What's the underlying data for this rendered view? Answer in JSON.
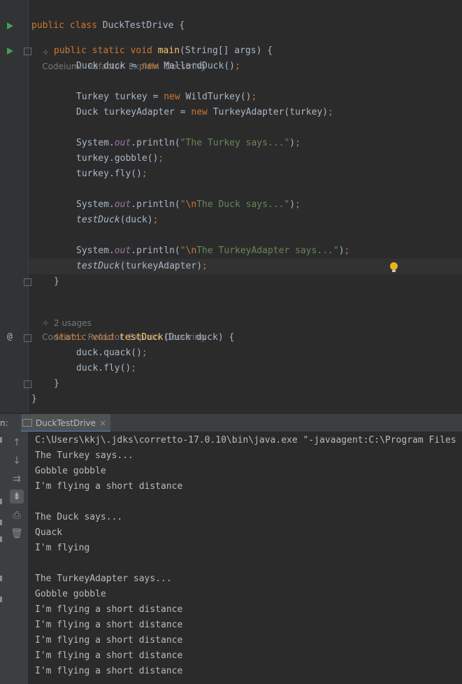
{
  "editor": {
    "class_line": {
      "kw": "public class ",
      "name": "DuckTestDrive",
      "rest": " {"
    },
    "codeium_hint": {
      "label": "Codeium:",
      "actions": [
        "Refactor",
        "Explain",
        "Docstring"
      ]
    },
    "main_sig": {
      "kw": "public static void ",
      "name": "main",
      "rest": "(String[] args) {"
    },
    "l_duck": {
      "pre": "Duck duck = ",
      "kw": "new ",
      "rest": "MallardDuck()",
      "semi": ";"
    },
    "l_turkey": {
      "pre": "Turkey turkey = ",
      "kw": "new ",
      "rest": "WildTurkey()",
      "semi": ";"
    },
    "l_adapter": {
      "pre": "Duck turkeyAdapter = ",
      "kw": "new ",
      "rest": "TurkeyAdapter(turkey)",
      "semi": ";"
    },
    "l_print1": {
      "a": "System.",
      "out": "out",
      "b": ".println(",
      "str": "\"The Turkey says...\"",
      "c": ")",
      "semi": ";"
    },
    "l_gobble": {
      "a": "turkey.gobble()",
      "semi": ";"
    },
    "l_fly": {
      "a": "turkey.fly()",
      "semi": ";"
    },
    "l_print2": {
      "a": "System.",
      "out": "out",
      "b": ".println(",
      "q": "\"",
      "esc": "\\n",
      "str": "The Duck says...\"",
      "c": ")",
      "semi": ";"
    },
    "l_test1": {
      "fn": "testDuck",
      "a": "(duck)",
      "semi": ";"
    },
    "l_print3": {
      "a": "System.",
      "out": "out",
      "b": ".println(",
      "q": "\"",
      "esc": "\\n",
      "str": "The TurkeyAdapter says...\"",
      "c": ")",
      "semi": ";"
    },
    "l_test2": {
      "fn": "testDuck",
      "a": "(turkeyAdapter)",
      "semi": ";"
    },
    "close_brace": "}",
    "usages": "2 usages",
    "test_sig": {
      "kw": "static void ",
      "name": "testDuck",
      "rest": "(Duck duck) {"
    },
    "l_quack": {
      "a": "duck.quack()",
      "semi": ";"
    },
    "l_dfly": {
      "a": "duck.fly()",
      "semi": ";"
    }
  },
  "run_panel": {
    "prefix": "n:",
    "tab_label": "DuckTestDrive",
    "close_glyph": "×",
    "output": [
      "C:\\Users\\kkj\\.jdks\\corretto-17.0.10\\bin\\java.exe \"-javaagent:C:\\Program Files",
      "The Turkey says...",
      "Gobble gobble",
      "I'm flying a short distance",
      "",
      "The Duck says...",
      "Quack",
      "I'm flying",
      "",
      "The TurkeyAdapter says...",
      "Gobble gobble",
      "I'm flying a short distance",
      "I'm flying a short distance",
      "I'm flying a short distance",
      "I'm flying a short distance",
      "I'm flying a short distance"
    ]
  },
  "icons": {
    "run_icon": "run-triangle",
    "fold_icon": "fold-marker",
    "override_icon": "@",
    "bulb_icon": "lightbulb-icon",
    "sparkle_icon": "✧"
  }
}
